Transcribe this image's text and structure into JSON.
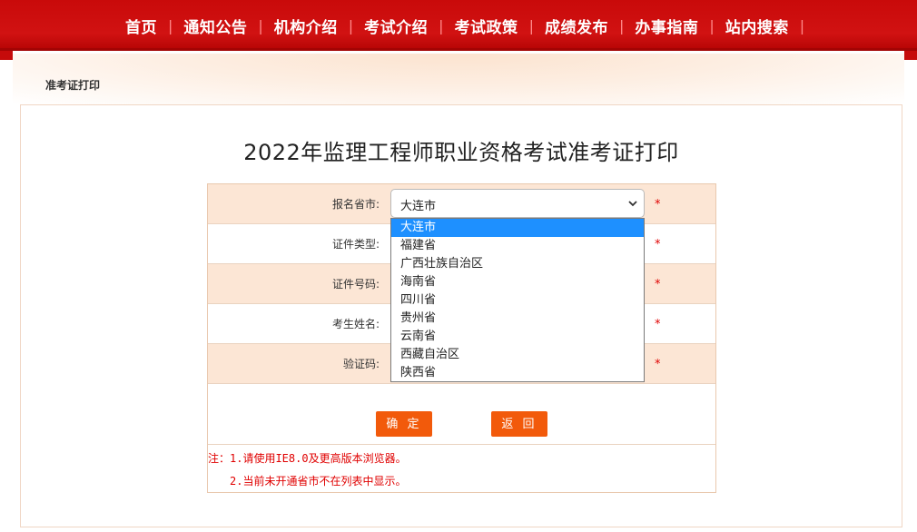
{
  "nav": {
    "items": [
      "首页",
      "通知公告",
      "机构介绍",
      "考试介绍",
      "考试政策",
      "成绩发布",
      "办事指南",
      "站内搜索"
    ]
  },
  "breadcrumb": "准考证打印",
  "page_title": "2022年监理工程师职业资格考试准考证打印",
  "form": {
    "province_label": "报名省市:",
    "province_selected": "大连市",
    "id_type_label": "证件类型:",
    "id_number_label": "证件号码:",
    "name_label": "考生姓名:",
    "captcha_label": "验证码:",
    "required_mark": "*"
  },
  "dropdown": {
    "options": [
      "大连市",
      "福建省",
      "广西壮族自治区",
      "海南省",
      "四川省",
      "贵州省",
      "云南省",
      "西藏自治区",
      "陕西省"
    ]
  },
  "buttons": {
    "confirm": "确 定",
    "back": "返 回"
  },
  "notes": {
    "line1": "注：1.请使用IE8.0及更高版本浏览器。",
    "line2": "2.当前未开通省市不在列表中显示。"
  },
  "colors": {
    "nav_bg": "#c90a0a",
    "row_tint": "#fce6d5",
    "button": "#f25a0b",
    "required": "#e00000",
    "dropdown_highlight": "#1e90ff"
  },
  "icons": {
    "select_arrow": "chevron-down-icon"
  }
}
